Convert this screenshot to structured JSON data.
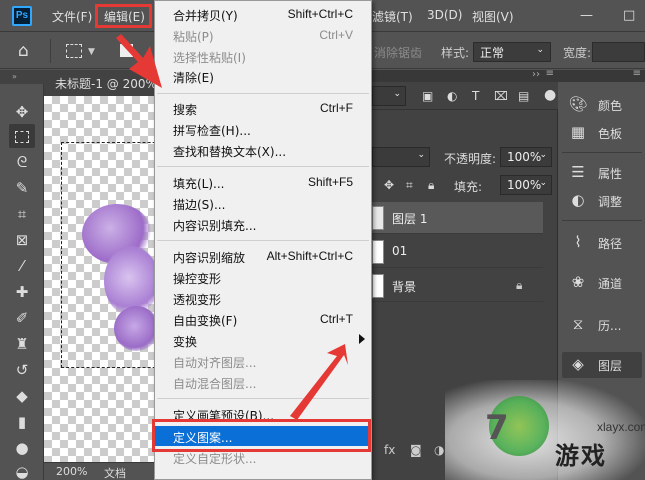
{
  "menubar": {
    "logo": "Ps",
    "items": [
      "文件(F)",
      "编辑(E)",
      "滤镜(T)",
      "3D(D)",
      "视图(V)"
    ],
    "window_controls": [
      "—",
      "□"
    ]
  },
  "options": {
    "antialias_label": "消除锯齿",
    "style_label": "样式:",
    "style_value": "正常",
    "width_label": "宽度:"
  },
  "document": {
    "tab_title": "未标题-1 @ 200%",
    "zoom": "200%",
    "status": "文档"
  },
  "edit_menu": {
    "items": [
      {
        "label": "合并拷贝(Y)",
        "shortcut": "Shift+Ctrl+C",
        "disabled": false
      },
      {
        "label": "粘贴(P)",
        "shortcut": "Ctrl+V",
        "disabled": true
      },
      {
        "label": "选择性粘贴(I)",
        "shortcut": "",
        "disabled": true
      },
      {
        "label": "清除(E)",
        "shortcut": "",
        "disabled": false
      },
      {
        "label": "搜索",
        "shortcut": "Ctrl+F",
        "disabled": false
      },
      {
        "label": "拼写检查(H)...",
        "shortcut": "",
        "disabled": false
      },
      {
        "label": "查找和替换文本(X)...",
        "shortcut": "",
        "disabled": false
      },
      {
        "label": "填充(L)...",
        "shortcut": "Shift+F5",
        "disabled": false
      },
      {
        "label": "描边(S)...",
        "shortcut": "",
        "disabled": false
      },
      {
        "label": "内容识别填充...",
        "shortcut": "",
        "disabled": false
      },
      {
        "label": "内容识别缩放",
        "shortcut": "Alt+Shift+Ctrl+C",
        "disabled": false
      },
      {
        "label": "操控变形",
        "shortcut": "",
        "disabled": false
      },
      {
        "label": "透视变形",
        "shortcut": "",
        "disabled": false
      },
      {
        "label": "自由变换(F)",
        "shortcut": "Ctrl+T",
        "disabled": false
      },
      {
        "label": "变换",
        "shortcut": "",
        "disabled": false
      },
      {
        "label": "自动对齐图层...",
        "shortcut": "",
        "disabled": true
      },
      {
        "label": "自动混合图层...",
        "shortcut": "",
        "disabled": true
      },
      {
        "label": "定义画笔预设(B)...",
        "shortcut": "",
        "disabled": false
      },
      {
        "label": "定义图案...",
        "shortcut": "",
        "disabled": false
      },
      {
        "label": "定义自定形状...",
        "shortcut": "",
        "disabled": true
      }
    ]
  },
  "layers_panel": {
    "opacity_label": "不透明度:",
    "opacity_value": "100%",
    "fill_label": "填充:",
    "fill_value": "100%",
    "layers": [
      {
        "name": "图层 1"
      },
      {
        "name": "01"
      },
      {
        "name": "背景"
      }
    ],
    "fx_label": "fx"
  },
  "side_panels": [
    {
      "icon": "palette-icon",
      "label": "颜色"
    },
    {
      "icon": "grid-icon",
      "label": "色板"
    },
    {
      "icon": "properties-icon",
      "label": "属性"
    },
    {
      "icon": "adjust-icon",
      "label": "调整"
    },
    {
      "icon": "paths-icon",
      "label": "路径"
    },
    {
      "icon": "channels-icon",
      "label": "通道"
    },
    {
      "icon": "history-icon",
      "label": "历..."
    },
    {
      "icon": "layers-icon",
      "label": "图层"
    }
  ],
  "watermark": {
    "big_char": "7",
    "text": "游戏",
    "url": "xlayx.com"
  },
  "colors": {
    "highlight": "#0a6fd6",
    "annotation_red": "#e53935"
  }
}
